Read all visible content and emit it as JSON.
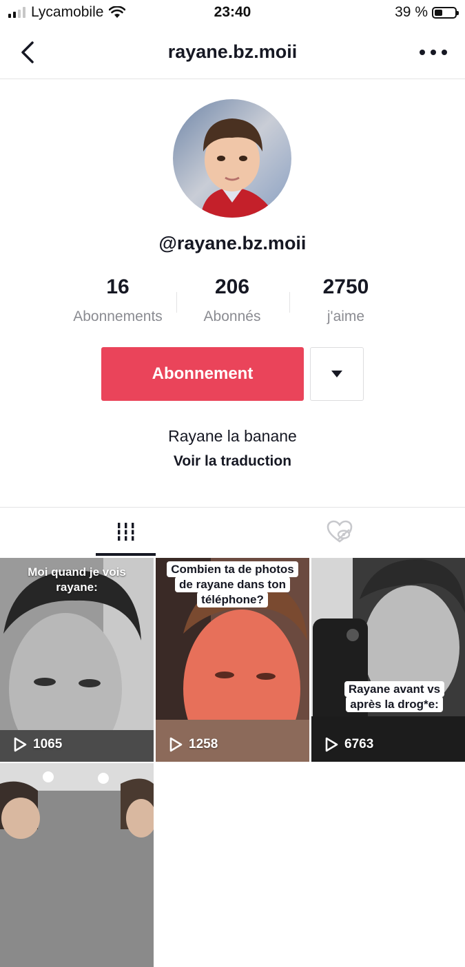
{
  "status_bar": {
    "carrier": "Lycamobile",
    "time": "23:40",
    "battery_percent": "39 %",
    "battery_level": 0.39
  },
  "nav": {
    "title": "rayane.bz.moii",
    "back_icon": "chevron-left-icon",
    "more_icon": "more-horizontal-icon"
  },
  "profile": {
    "handle": "@rayane.bz.moii",
    "stats": [
      {
        "value": "16",
        "label": "Abonnements"
      },
      {
        "value": "206",
        "label": "Abonnés"
      },
      {
        "value": "2750",
        "label": "j'aime"
      }
    ],
    "follow_label": "Abonnement",
    "bio": "Rayane la banane",
    "translate_label": "Voir la traduction"
  },
  "colors": {
    "accent": "#ea445a",
    "text": "#161823",
    "muted": "#8a8b91"
  },
  "tabs": [
    {
      "icon": "grid-bars-icon",
      "active": true
    },
    {
      "icon": "liked-hidden-icon",
      "active": false
    }
  ],
  "videos": [
    {
      "caption": "Moi quand je vois rayane:",
      "views": "1065"
    },
    {
      "caption": "Combien ta de photos de rayane dans ton téléphone?",
      "views": "1258"
    },
    {
      "caption": "Rayane avant vs après la drog*e:",
      "views": "6763"
    },
    {
      "caption": "",
      "views": ""
    }
  ]
}
